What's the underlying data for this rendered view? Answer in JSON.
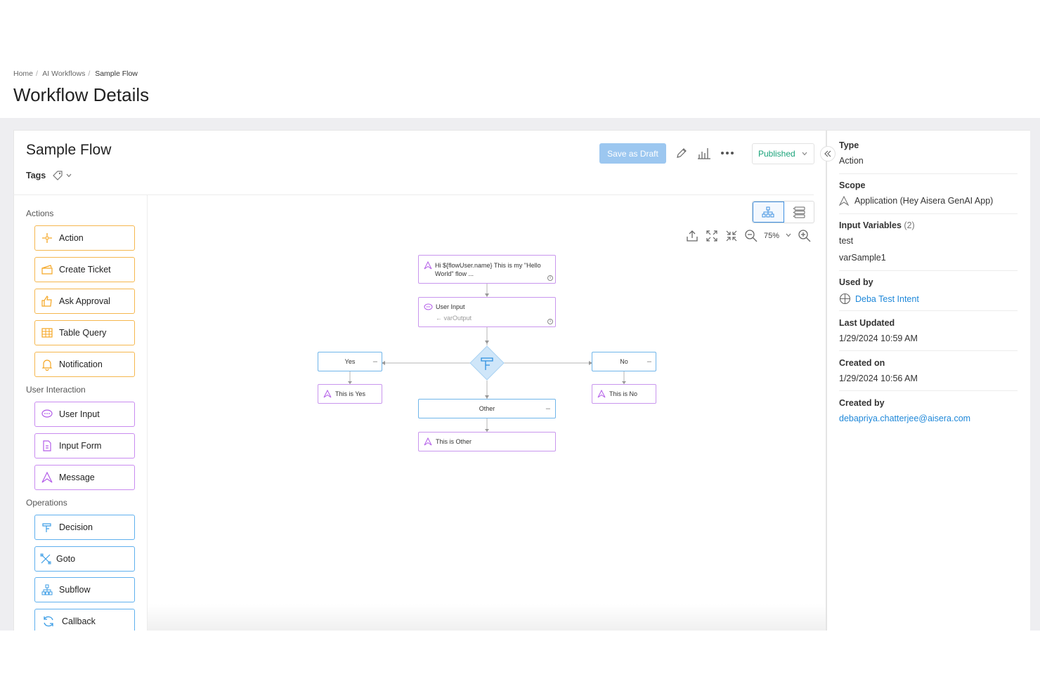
{
  "breadcrumb": {
    "home": "Home",
    "section": "AI Workflows",
    "current": "Sample Flow"
  },
  "page_title": "Workflow Details",
  "flow": {
    "name": "Sample Flow",
    "tags_label": "Tags",
    "save_draft_label": "Save as Draft",
    "status": "Published"
  },
  "palette": {
    "actions_label": "Actions",
    "actions": [
      "Action",
      "Create Ticket",
      "Ask Approval",
      "Table Query",
      "Notification"
    ],
    "user_interaction_label": "User Interaction",
    "user_interaction": [
      "User Input",
      "Input Form",
      "Message"
    ],
    "operations_label": "Operations",
    "operations": [
      "Decision",
      "Goto",
      "Subflow",
      "Callback"
    ]
  },
  "canvas": {
    "zoom": "75%",
    "nodes": {
      "message": "Hi ${flowUser.name} This is my \"Hello World\" flow ...",
      "user_input": "User Input",
      "user_input_var": "varOutput",
      "yes": "Yes",
      "no": "No",
      "other": "Other",
      "this_is_yes": "This is Yes",
      "this_is_no": "This is No",
      "this_is_other": "This is Other"
    }
  },
  "properties": {
    "type_label": "Type",
    "type_value": "Action",
    "scope_label": "Scope",
    "scope_value": "Application (Hey Aisera GenAI App)",
    "input_vars_label": "Input Variables",
    "input_vars_count": "(2)",
    "input_vars": [
      "test",
      "varSample1"
    ],
    "used_by_label": "Used by",
    "used_by_value": "Deba Test Intent",
    "last_updated_label": "Last Updated",
    "last_updated_value": "1/29/2024 10:59 AM",
    "created_on_label": "Created on",
    "created_on_value": "1/29/2024 10:56 AM",
    "created_by_label": "Created by",
    "created_by_value": "debapriya.chatterjee@aisera.com"
  },
  "colors": {
    "accent": "#1f88d9",
    "published": "#1aa37a",
    "action_border": "#f5b74e",
    "interaction_border": "#c98bf0",
    "operation_border": "#5fb0ee"
  }
}
